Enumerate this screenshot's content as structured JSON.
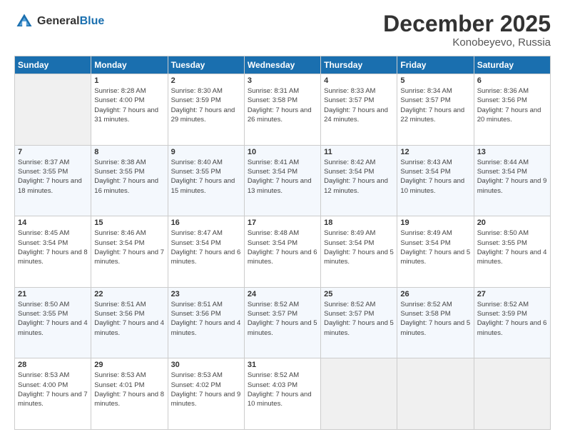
{
  "header": {
    "logo_line1": "General",
    "logo_line2": "Blue",
    "month_title": "December 2025",
    "location": "Konobeyevo, Russia"
  },
  "days_of_week": [
    "Sunday",
    "Monday",
    "Tuesday",
    "Wednesday",
    "Thursday",
    "Friday",
    "Saturday"
  ],
  "weeks": [
    [
      {
        "day": null
      },
      {
        "day": "1",
        "sunrise": "8:28 AM",
        "sunset": "4:00 PM",
        "daylight": "7 hours and 31 minutes."
      },
      {
        "day": "2",
        "sunrise": "8:30 AM",
        "sunset": "3:59 PM",
        "daylight": "7 hours and 29 minutes."
      },
      {
        "day": "3",
        "sunrise": "8:31 AM",
        "sunset": "3:58 PM",
        "daylight": "7 hours and 26 minutes."
      },
      {
        "day": "4",
        "sunrise": "8:33 AM",
        "sunset": "3:57 PM",
        "daylight": "7 hours and 24 minutes."
      },
      {
        "day": "5",
        "sunrise": "8:34 AM",
        "sunset": "3:57 PM",
        "daylight": "7 hours and 22 minutes."
      },
      {
        "day": "6",
        "sunrise": "8:36 AM",
        "sunset": "3:56 PM",
        "daylight": "7 hours and 20 minutes."
      }
    ],
    [
      {
        "day": "7",
        "sunrise": "8:37 AM",
        "sunset": "3:55 PM",
        "daylight": "7 hours and 18 minutes."
      },
      {
        "day": "8",
        "sunrise": "8:38 AM",
        "sunset": "3:55 PM",
        "daylight": "7 hours and 16 minutes."
      },
      {
        "day": "9",
        "sunrise": "8:40 AM",
        "sunset": "3:55 PM",
        "daylight": "7 hours and 15 minutes."
      },
      {
        "day": "10",
        "sunrise": "8:41 AM",
        "sunset": "3:54 PM",
        "daylight": "7 hours and 13 minutes."
      },
      {
        "day": "11",
        "sunrise": "8:42 AM",
        "sunset": "3:54 PM",
        "daylight": "7 hours and 12 minutes."
      },
      {
        "day": "12",
        "sunrise": "8:43 AM",
        "sunset": "3:54 PM",
        "daylight": "7 hours and 10 minutes."
      },
      {
        "day": "13",
        "sunrise": "8:44 AM",
        "sunset": "3:54 PM",
        "daylight": "7 hours and 9 minutes."
      }
    ],
    [
      {
        "day": "14",
        "sunrise": "8:45 AM",
        "sunset": "3:54 PM",
        "daylight": "7 hours and 8 minutes."
      },
      {
        "day": "15",
        "sunrise": "8:46 AM",
        "sunset": "3:54 PM",
        "daylight": "7 hours and 7 minutes."
      },
      {
        "day": "16",
        "sunrise": "8:47 AM",
        "sunset": "3:54 PM",
        "daylight": "7 hours and 6 minutes."
      },
      {
        "day": "17",
        "sunrise": "8:48 AM",
        "sunset": "3:54 PM",
        "daylight": "7 hours and 6 minutes."
      },
      {
        "day": "18",
        "sunrise": "8:49 AM",
        "sunset": "3:54 PM",
        "daylight": "7 hours and 5 minutes."
      },
      {
        "day": "19",
        "sunrise": "8:49 AM",
        "sunset": "3:54 PM",
        "daylight": "7 hours and 5 minutes."
      },
      {
        "day": "20",
        "sunrise": "8:50 AM",
        "sunset": "3:55 PM",
        "daylight": "7 hours and 4 minutes."
      }
    ],
    [
      {
        "day": "21",
        "sunrise": "8:50 AM",
        "sunset": "3:55 PM",
        "daylight": "7 hours and 4 minutes."
      },
      {
        "day": "22",
        "sunrise": "8:51 AM",
        "sunset": "3:56 PM",
        "daylight": "7 hours and 4 minutes."
      },
      {
        "day": "23",
        "sunrise": "8:51 AM",
        "sunset": "3:56 PM",
        "daylight": "7 hours and 4 minutes."
      },
      {
        "day": "24",
        "sunrise": "8:52 AM",
        "sunset": "3:57 PM",
        "daylight": "7 hours and 5 minutes."
      },
      {
        "day": "25",
        "sunrise": "8:52 AM",
        "sunset": "3:57 PM",
        "daylight": "7 hours and 5 minutes."
      },
      {
        "day": "26",
        "sunrise": "8:52 AM",
        "sunset": "3:58 PM",
        "daylight": "7 hours and 5 minutes."
      },
      {
        "day": "27",
        "sunrise": "8:52 AM",
        "sunset": "3:59 PM",
        "daylight": "7 hours and 6 minutes."
      }
    ],
    [
      {
        "day": "28",
        "sunrise": "8:53 AM",
        "sunset": "4:00 PM",
        "daylight": "7 hours and 7 minutes."
      },
      {
        "day": "29",
        "sunrise": "8:53 AM",
        "sunset": "4:01 PM",
        "daylight": "7 hours and 8 minutes."
      },
      {
        "day": "30",
        "sunrise": "8:53 AM",
        "sunset": "4:02 PM",
        "daylight": "7 hours and 9 minutes."
      },
      {
        "day": "31",
        "sunrise": "8:52 AM",
        "sunset": "4:03 PM",
        "daylight": "7 hours and 10 minutes."
      },
      {
        "day": null
      },
      {
        "day": null
      },
      {
        "day": null
      }
    ]
  ]
}
